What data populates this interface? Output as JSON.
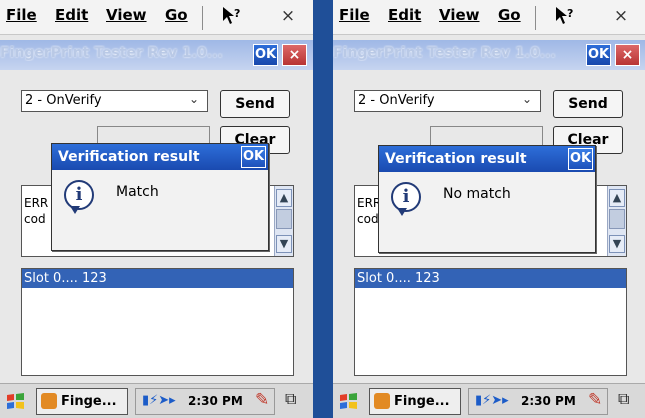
{
  "screens": [
    {
      "menu": {
        "file": "File",
        "edit": "Edit",
        "view": "View",
        "go": "Go",
        "help_icon": "help-icon",
        "close_glyph": "×"
      },
      "titlebar": {
        "title": "FingerPrint Tester Rev 1.0...",
        "ok_label": "OK",
        "close_label": "×"
      },
      "command_select": {
        "value": "2 - OnVerify",
        "arrow": "⌄"
      },
      "send_label": "Send",
      "clear_label": "Clear",
      "log": {
        "line1": "ERR",
        "line2": "cod"
      },
      "list": {
        "selected": "Slot 0.... 123"
      },
      "dialog": {
        "title": "Verification result",
        "ok_label": "OK",
        "message": "Match"
      },
      "taskbar": {
        "app_label": "Finge...",
        "time": "2:30 PM"
      }
    },
    {
      "menu": {
        "file": "File",
        "edit": "Edit",
        "view": "View",
        "go": "Go",
        "help_icon": "help-icon",
        "close_glyph": "×"
      },
      "titlebar": {
        "title": "FingerPrint Tester Rev 1.0...",
        "ok_label": "OK",
        "close_label": "×"
      },
      "command_select": {
        "value": "2 - OnVerify",
        "arrow": "⌄"
      },
      "send_label": "Send",
      "clear_label": "Clear",
      "log": {
        "line1": "ERR",
        "line2": "cod"
      },
      "list": {
        "selected": "Slot 0.... 123"
      },
      "dialog": {
        "title": "Verification result",
        "ok_label": "OK",
        "message": "No match"
      },
      "taskbar": {
        "app_label": "Finge...",
        "time": "2:30 PM"
      }
    }
  ],
  "colors": {
    "accent": "#1a4ab0",
    "background": "#2a58a0",
    "selection": "#3363b6"
  }
}
